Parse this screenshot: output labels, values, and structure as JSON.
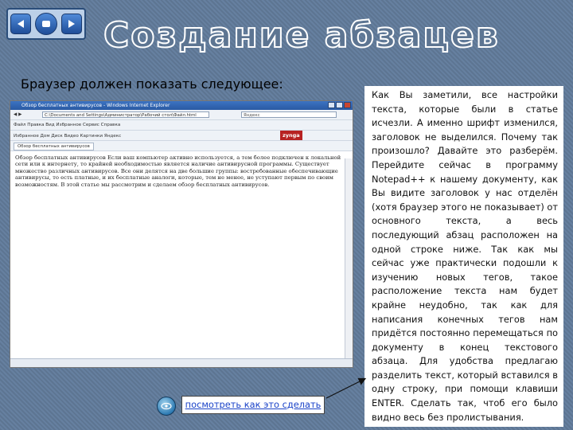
{
  "slide": {
    "title": "Создание абзацев",
    "subtitle": "Браузер должен показать следующее:",
    "explanation": "Как Вы заметили, все настройки текста, которые были в статье исчезли. А именно шрифт изменился, заголовок не выделился. Почему так произошло? Давайте это разберём. Перейдите сейчас в программу Notepad++ к нашему документу, как Вы видите заголовок у нас отделён (хотя браузер этого не показывает) от основного текста, а весь последующий абзац расположен на одной строке ниже. Так как мы сейчас уже практически подошли к изучению новых тегов, такое расположение текста нам будет крайне неудобно, так как для написания конечных тегов нам придётся постоянно перемещаться по документу в конец текстового абзаца. Для удобства предлагаю разделить текст, который вставился в одну строку, при помощи клавиши ENTER. Сделать так, чтоб его было видно весь без пролистывания.",
    "link_text": "посмотреть как это сделать"
  },
  "nav": {
    "back": "back-arrow-icon",
    "home": "home-icon",
    "forward": "forward-arrow-icon"
  },
  "browser": {
    "window_title": "Обзор бесплатных антивирусов - Windows Internet Explorer",
    "address": "C:\\Documents and Settings\\Администратор\\Рабочий стол\\Файл.html",
    "search_placeholder": "Яндекс",
    "menu": "Файл   Правка   Вид   Избранное   Сервис   Справка",
    "links": "Избранное    Дом   Диск   Видео   Картинки   Яндекс",
    "zynga": "zynga",
    "tab": "Обзор бесплатных антивирусов",
    "content": "Обзор бесплатных антивирусов Если ваш компьютер активно используется, а тем более подключен к локальной сети или к интернету, то крайней необходимостью является наличие антивирусной программы. Существует множество различных антивирусов. Все они делятся на две большие группы: востребованные обеспечивающие антивирусы, то есть платные, и их бесплатные аналоги, которые, тем не менее, не уступают первым по своим возможностям. В этой статье мы рассмотрим и сделаем обзор бесплатных антивирусов."
  },
  "colors": {
    "background": "#6680a0",
    "link": "#1b43c8",
    "title_outline": "#ffffff"
  }
}
